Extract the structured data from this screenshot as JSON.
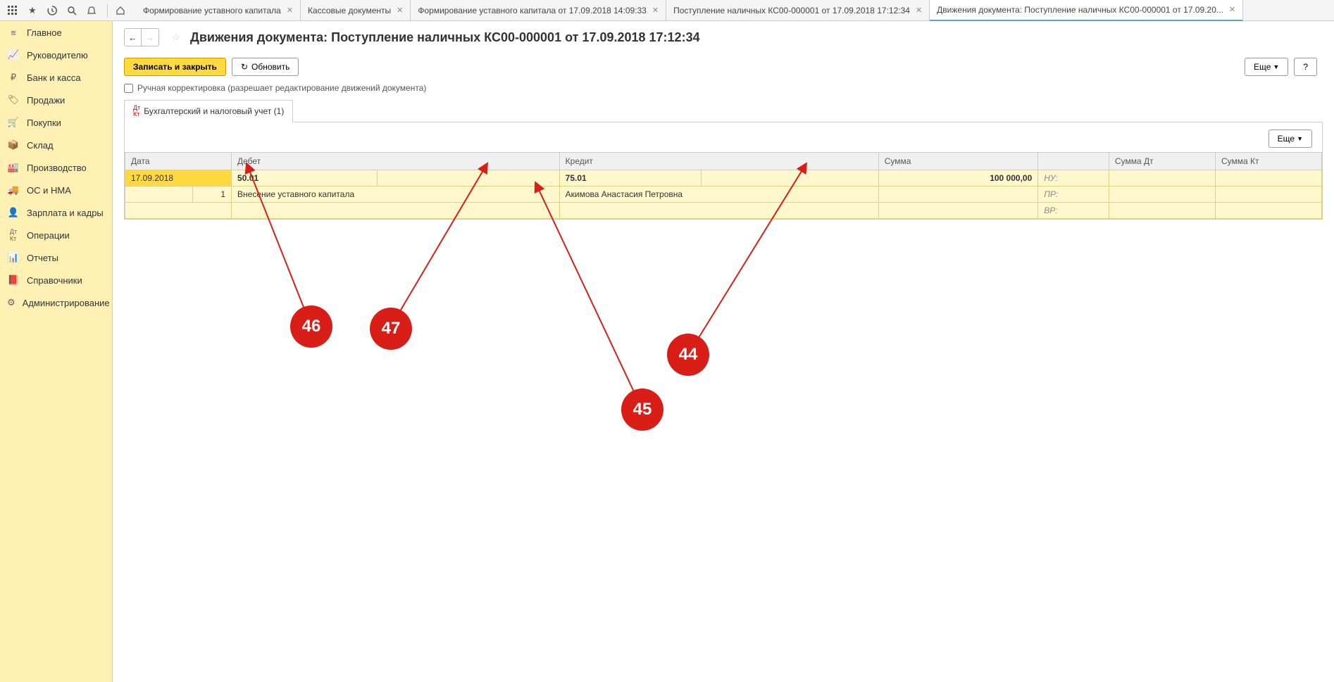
{
  "tabs": [
    {
      "label": "Формирование уставного капитала"
    },
    {
      "label": "Кассовые документы"
    },
    {
      "label": "Формирование уставного капитала от 17.09.2018 14:09:33"
    },
    {
      "label": "Поступление наличных КС00-000001 от 17.09.2018 17:12:34"
    },
    {
      "label": "Движения документа: Поступление наличных КС00-000001 от 17.09.20..."
    }
  ],
  "sidebar": {
    "items": [
      {
        "label": "Главное"
      },
      {
        "label": "Руководителю"
      },
      {
        "label": "Банк и касса"
      },
      {
        "label": "Продажи"
      },
      {
        "label": "Покупки"
      },
      {
        "label": "Склад"
      },
      {
        "label": "Производство"
      },
      {
        "label": "ОС и НМА"
      },
      {
        "label": "Зарплата и кадры"
      },
      {
        "label": "Операции"
      },
      {
        "label": "Отчеты"
      },
      {
        "label": "Справочники"
      },
      {
        "label": "Администрирование"
      }
    ]
  },
  "page_title": "Движения документа: Поступление наличных КС00-000001 от 17.09.2018 17:12:34",
  "toolbar": {
    "save_close": "Записать и закрыть",
    "refresh": "Обновить",
    "more": "Еще",
    "help": "?"
  },
  "checkbox_label": "Ручная корректировка (разрешает редактирование движений документа)",
  "inner_tab": "Бухгалтерский и налоговый учет (1)",
  "table": {
    "headers": {
      "date": "Дата",
      "debit": "Дебет",
      "credit": "Кредит",
      "sum": "Сумма",
      "sum_dt": "Сумма Дт",
      "sum_kt": "Сумма Кт"
    },
    "row": {
      "date": "17.09.2018",
      "num": "1",
      "debit_account": "50.01",
      "debit_desc": "Внесение уставного капитала",
      "credit_account": "75.01",
      "credit_desc": "Акимова Анастасия Петровна",
      "sum": "100 000,00",
      "nu": "НУ:",
      "pr": "ПР:",
      "vr": "ВР:"
    }
  },
  "annotations": {
    "a44": "44",
    "a45": "45",
    "a46": "46",
    "a47": "47"
  }
}
